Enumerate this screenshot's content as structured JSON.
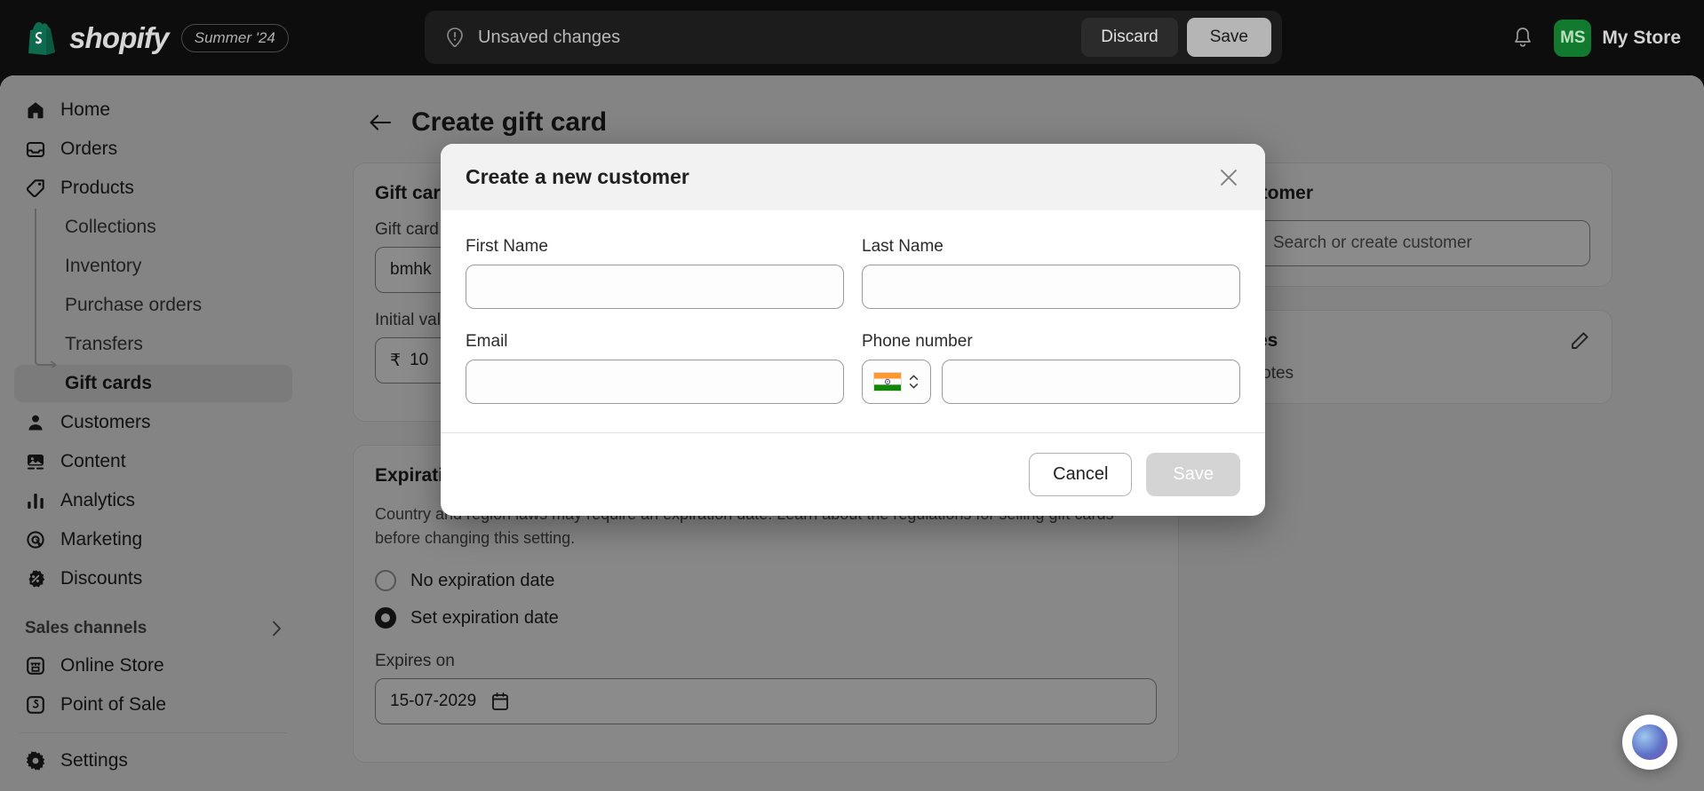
{
  "topbar": {
    "brand_name": "shopify",
    "release_pill": "Summer '24",
    "savebar_text": "Unsaved changes",
    "discard_label": "Discard",
    "save_label": "Save",
    "avatar_initials": "MS",
    "store_name": "My Store",
    "accent_green": "#127a2e",
    "bar_bg": "#1c1c1c"
  },
  "sidebar": {
    "items": [
      {
        "label": "Home",
        "icon": "home-icon"
      },
      {
        "label": "Orders",
        "icon": "orders-icon"
      },
      {
        "label": "Products",
        "icon": "tag-icon"
      }
    ],
    "sub_items": [
      {
        "label": "Collections"
      },
      {
        "label": "Inventory"
      },
      {
        "label": "Purchase orders"
      },
      {
        "label": "Transfers"
      },
      {
        "label": "Gift cards"
      }
    ],
    "items2": [
      {
        "label": "Customers",
        "icon": "person-icon"
      },
      {
        "label": "Content",
        "icon": "content-icon"
      },
      {
        "label": "Analytics",
        "icon": "analytics-icon"
      },
      {
        "label": "Marketing",
        "icon": "marketing-icon"
      },
      {
        "label": "Discounts",
        "icon": "discount-icon"
      }
    ],
    "group_title": "Sales channels",
    "channels": [
      {
        "label": "Online Store",
        "icon": "store-icon"
      },
      {
        "label": "Point of Sale",
        "icon": "pos-icon"
      }
    ],
    "settings_label": "Settings",
    "active_item": "Gift cards"
  },
  "main": {
    "page_title": "Create gift card",
    "gift_card_details": {
      "card_title": "Gift card details",
      "code_label": "Gift card code",
      "code_value": "bmhk",
      "amount_label": "Initial value",
      "currency_symbol": "₹",
      "amount_value": "10"
    },
    "expiration": {
      "card_title": "Expiration date",
      "help_text": "Country and region laws may require an expiration date. Learn about the regulations for selling gift cards before changing this setting.",
      "option_no_expiry": "No expiration date",
      "option_set_expiry": "Set expiration date",
      "selected": "Set expiration date",
      "expires_label": "Expires on",
      "expires_value": "15-07-2029"
    },
    "customer": {
      "card_title": "Customer",
      "search_placeholder": "Search or create customer"
    },
    "notes": {
      "card_title": "Notes",
      "body_text": "No notes"
    }
  },
  "modal": {
    "title": "Create a new customer",
    "first_name_label": "First Name",
    "first_name_value": "",
    "last_name_label": "Last Name",
    "last_name_value": "",
    "email_label": "Email",
    "email_value": "",
    "phone_label": "Phone number",
    "phone_value": "",
    "country_flag": "india-flag",
    "cancel_label": "Cancel",
    "save_label": "Save"
  }
}
